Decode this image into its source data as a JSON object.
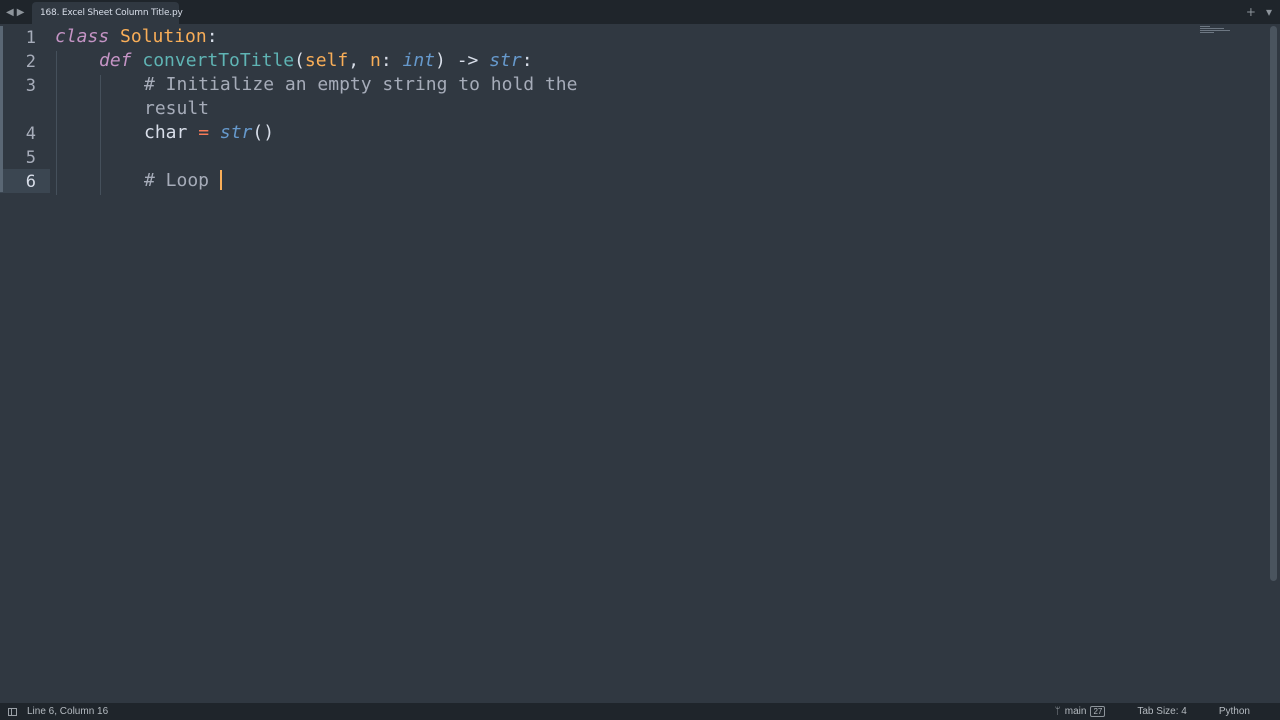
{
  "tabbar": {
    "back_icon": "◀",
    "forward_icon": "▶",
    "active_tab": {
      "title": "168. Excel Sheet Column Title.py",
      "dirty": true
    },
    "new_tab_icon": "+",
    "tab_list_icon": "▾"
  },
  "editor": {
    "line_numbers": [
      "1",
      "2",
      "3",
      "",
      "4",
      "5",
      "6"
    ],
    "active_line": "6",
    "lines": {
      "l1": {
        "kw": "class",
        "name": "Solution",
        "colon": ":"
      },
      "l2": {
        "kw": "def",
        "fn": "convertToTitle",
        "open": "(",
        "self": "self",
        "comma": ", ",
        "n": "n",
        "colon1": ": ",
        "int": "int",
        "close": ")",
        "arrow": " -> ",
        "str": "str",
        "colon2": ":"
      },
      "l3a": "# Initialize an empty string to hold the",
      "l3b": "result",
      "l4": {
        "var": "char",
        "eq": " = ",
        "call": "str",
        "parens": "()"
      },
      "l6": "# Loop "
    },
    "colors": {
      "background": "#303841",
      "keyword": "#c594c5",
      "class_name": "#f9ae58",
      "function": "#5fb4b4",
      "type": "#6699cc",
      "operator": "#f97b58",
      "comment": "#a6acb9",
      "caret": "#f9ae58"
    }
  },
  "statusbar": {
    "position": "Line 6, Column 16",
    "branch": "main",
    "branch_badge": "27",
    "tab_size": "Tab Size: 4",
    "syntax": "Python"
  }
}
